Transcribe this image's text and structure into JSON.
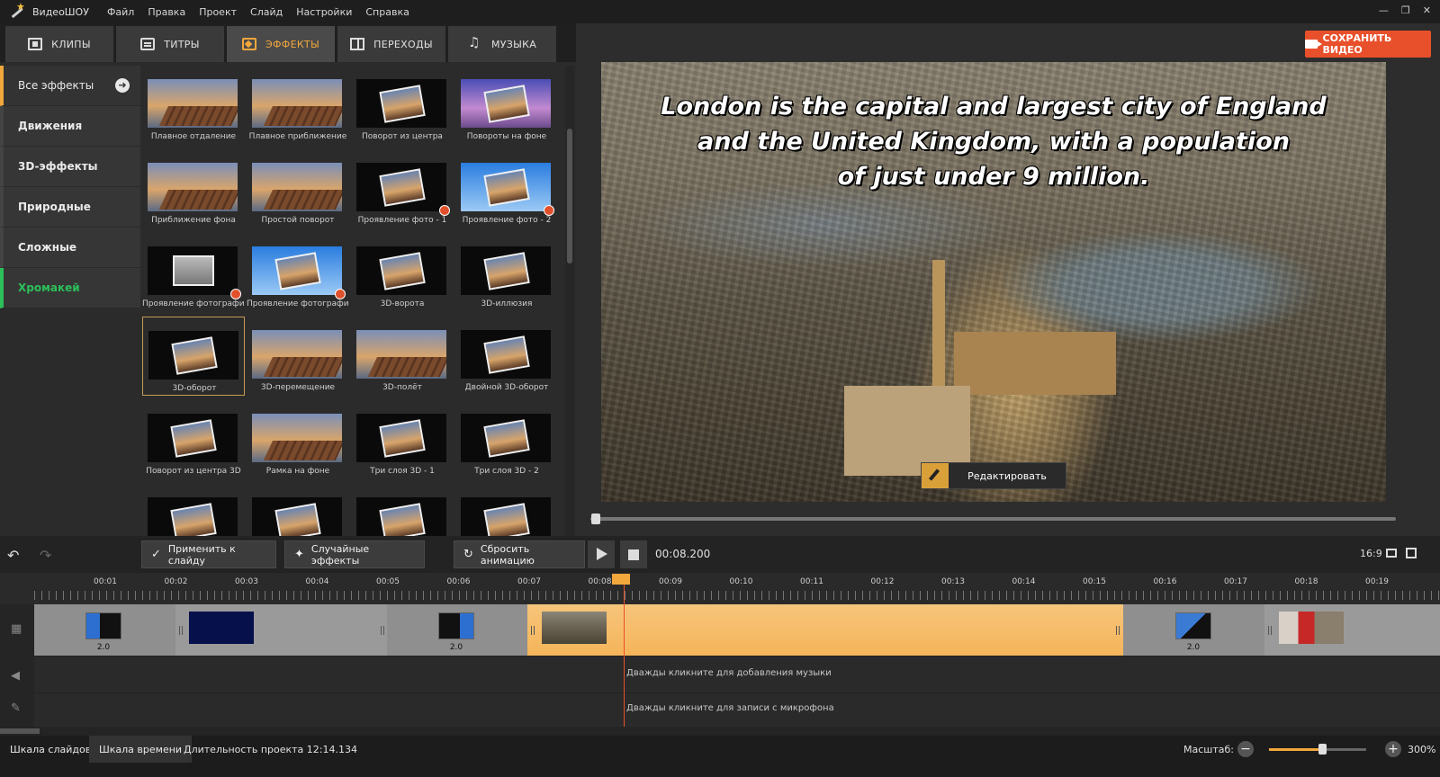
{
  "app": {
    "title": "ВидеоШОУ",
    "menu": [
      "Файл",
      "Правка",
      "Проект",
      "Слайд",
      "Настройки",
      "Справка"
    ]
  },
  "tabs": [
    {
      "label": "КЛИПЫ",
      "icon": "film-icon"
    },
    {
      "label": "ТИТРЫ",
      "icon": "titles-icon"
    },
    {
      "label": "ЭФФЕКТЫ",
      "icon": "effects-icon",
      "active": true
    },
    {
      "label": "ПЕРЕХОДЫ",
      "icon": "transitions-icon"
    },
    {
      "label": "МУЗЫКА",
      "icon": "music-icon"
    }
  ],
  "save_button": {
    "label": "СОХРАНИТЬ ВИДЕО",
    "icon": "camera-icon",
    "color": "#e8502b"
  },
  "categories": [
    {
      "label": "Все эффекты",
      "active": true
    },
    {
      "label": "Движения"
    },
    {
      "label": "3D-эффекты"
    },
    {
      "label": "Природные"
    },
    {
      "label": "Сложные"
    },
    {
      "label": "Хромакей",
      "color": "#2cbf5a"
    }
  ],
  "effects": [
    {
      "label": "Плавное отдаление",
      "thumb": "sky"
    },
    {
      "label": "Плавное приближение",
      "thumb": "sky"
    },
    {
      "label": "Поворот из центра",
      "thumb": "dark"
    },
    {
      "label": "Повороты на фоне",
      "thumb": "purple"
    },
    {
      "label": "Приближение фона",
      "thumb": "sky"
    },
    {
      "label": "Простой поворот",
      "thumb": "sky"
    },
    {
      "label": "Проявление фото - 1",
      "thumb": "dark",
      "badge": true
    },
    {
      "label": "Проявление фото - 2",
      "thumb": "blue",
      "badge": true
    },
    {
      "label": "Проявление фотографии...",
      "thumb": "dark",
      "badge": true
    },
    {
      "label": "Проявление фотографии...",
      "thumb": "blue",
      "badge": true
    },
    {
      "label": "3D-ворота",
      "thumb": "dark"
    },
    {
      "label": "3D-иллюзия",
      "thumb": "dark"
    },
    {
      "label": "3D-оборот",
      "thumb": "dark",
      "selected": true
    },
    {
      "label": "3D-перемещение",
      "thumb": "sky"
    },
    {
      "label": "3D-полёт",
      "thumb": "sky"
    },
    {
      "label": "Двойной 3D-оборот",
      "thumb": "dark"
    },
    {
      "label": "Поворот из центра 3D",
      "thumb": "dark"
    },
    {
      "label": "Рамка на фоне",
      "thumb": "sky"
    },
    {
      "label": "Три слоя 3D - 1",
      "thumb": "dark"
    },
    {
      "label": "Три слоя 3D - 2",
      "thumb": "dark"
    },
    {
      "label": "",
      "thumb": "dark"
    },
    {
      "label": "",
      "thumb": "dark"
    },
    {
      "label": "",
      "thumb": "dark"
    },
    {
      "label": "",
      "thumb": "dark"
    }
  ],
  "preview": {
    "caption_lines": [
      "London is the capital and largest city of England",
      "and the United Kingdom, with a population",
      "of just under 9 million."
    ],
    "edit_button": "Редактировать"
  },
  "toolbar": {
    "apply": "Применить к слайду",
    "random": "Случайные эффекты",
    "reset": "Сбросить анимацию",
    "timecode": "00:08.200",
    "aspect": "16:9"
  },
  "timeline": {
    "ticks": [
      "00:01",
      "00:02",
      "00:03",
      "00:04",
      "00:05",
      "00:06",
      "00:07",
      "00:08",
      "00:09",
      "00:10",
      "00:11",
      "00:12",
      "00:13",
      "00:14",
      "00:15",
      "00:16",
      "00:17",
      "00:18",
      "00:19"
    ],
    "transition_durations": [
      "2.0",
      "2.0",
      "2.0"
    ],
    "music_hint": "Дважды кликните для добавления музыки",
    "mic_hint": "Дважды кликните для записи с микрофона"
  },
  "status": {
    "tab_slides": "Шкала слайдов",
    "tab_timeline": "Шкала времени",
    "duration": "Длительность проекта 12:14.134",
    "zoom_label": "Масштаб:",
    "zoom_value": "300%",
    "zoom_fraction": 0.55
  }
}
